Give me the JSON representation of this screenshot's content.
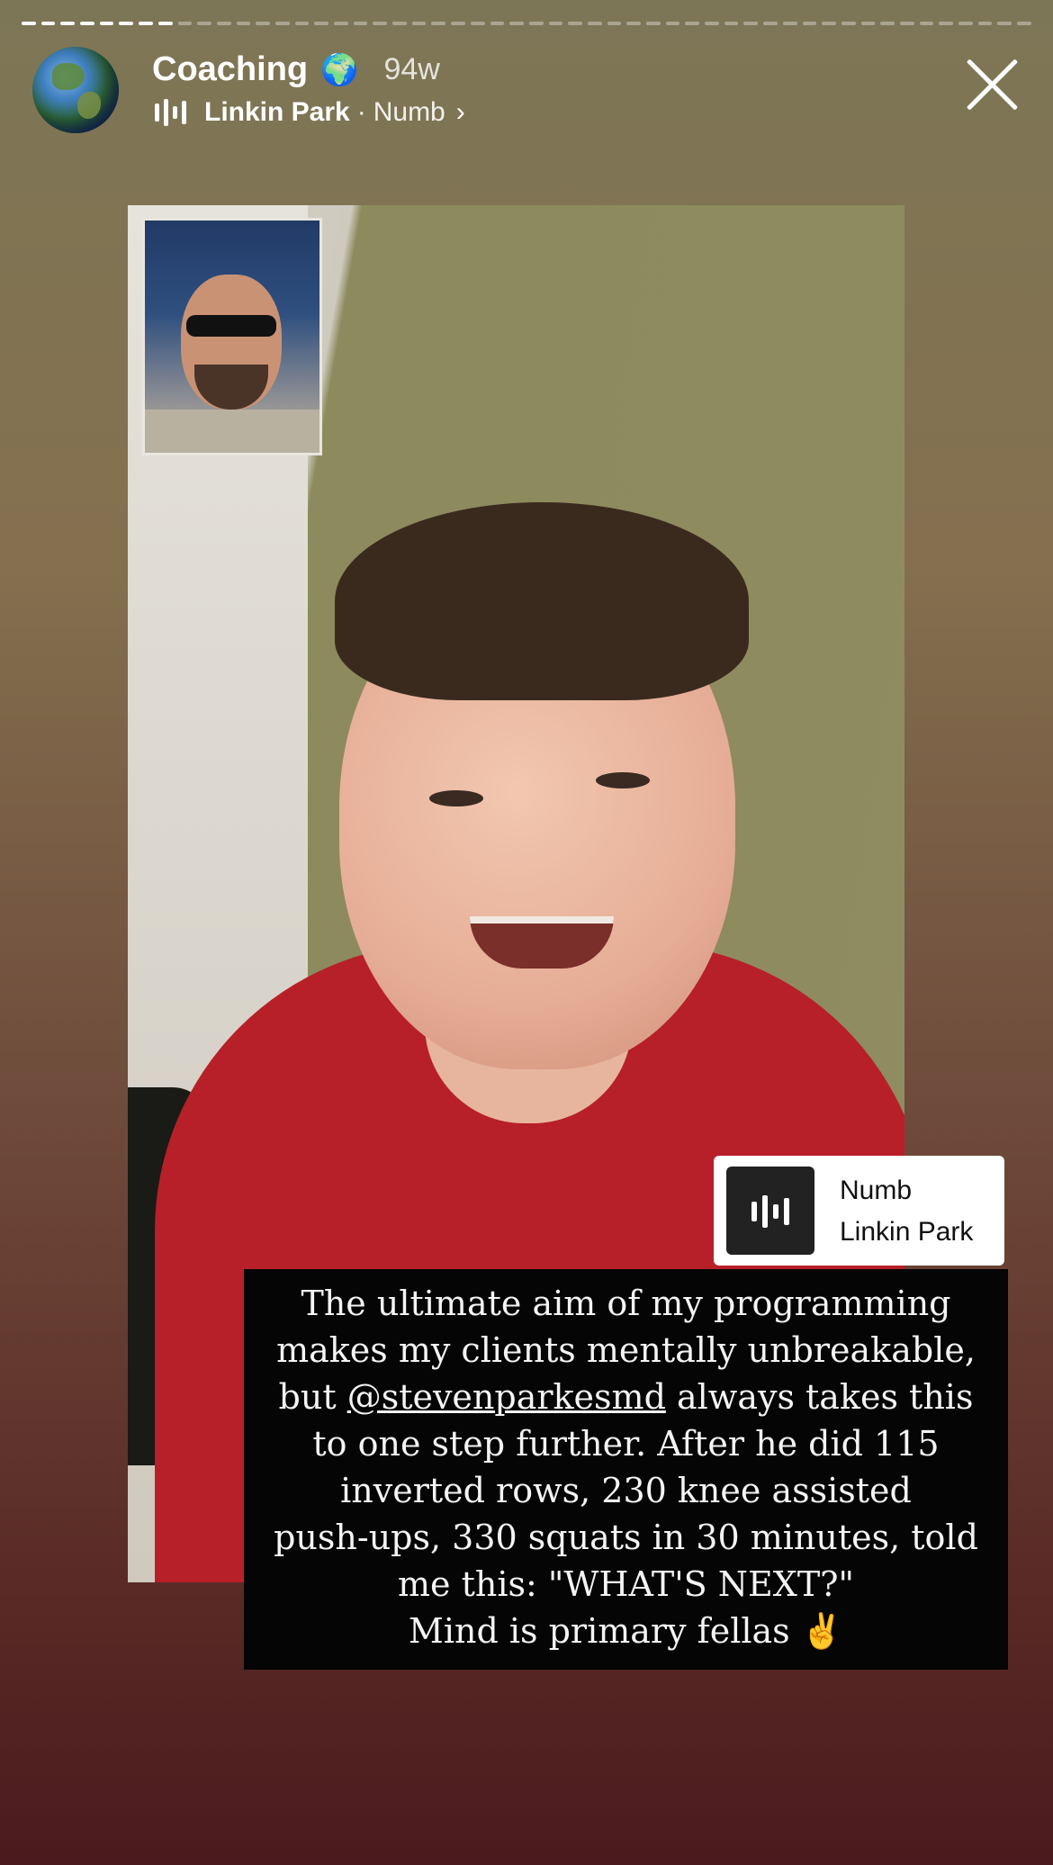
{
  "story": {
    "progress": {
      "segments_total": 52,
      "segments_done": 8
    }
  },
  "header": {
    "username": "Coaching",
    "username_emoji": "🌍",
    "age": "94w",
    "music": {
      "artist": "Linkin Park",
      "separator": "·",
      "song": "Numb",
      "chevron": "›"
    }
  },
  "music_sticker": {
    "song": "Numb",
    "artist": "Linkin Park"
  },
  "caption": {
    "line1": "The ultimate aim of my programming",
    "line2": "makes my clients mentally unbreakable,",
    "line3_pre": "but ",
    "mention": "@stevenparkesmd",
    "line3_post": " always takes this",
    "line4": "to one step further. After he did 115",
    "line5": "inverted rows, 230 knee assisted",
    "line6": "push-ups, 330 squats in 30 minutes, told",
    "line7": "me this: \"WHAT'S NEXT?\"",
    "line8": "Mind is primary fellas ✌️"
  },
  "colors": {
    "bg_top": "#7d7656",
    "bg_bottom": "#4a1a1e",
    "shirt": "#b72028",
    "caption_bg": "#050505"
  }
}
